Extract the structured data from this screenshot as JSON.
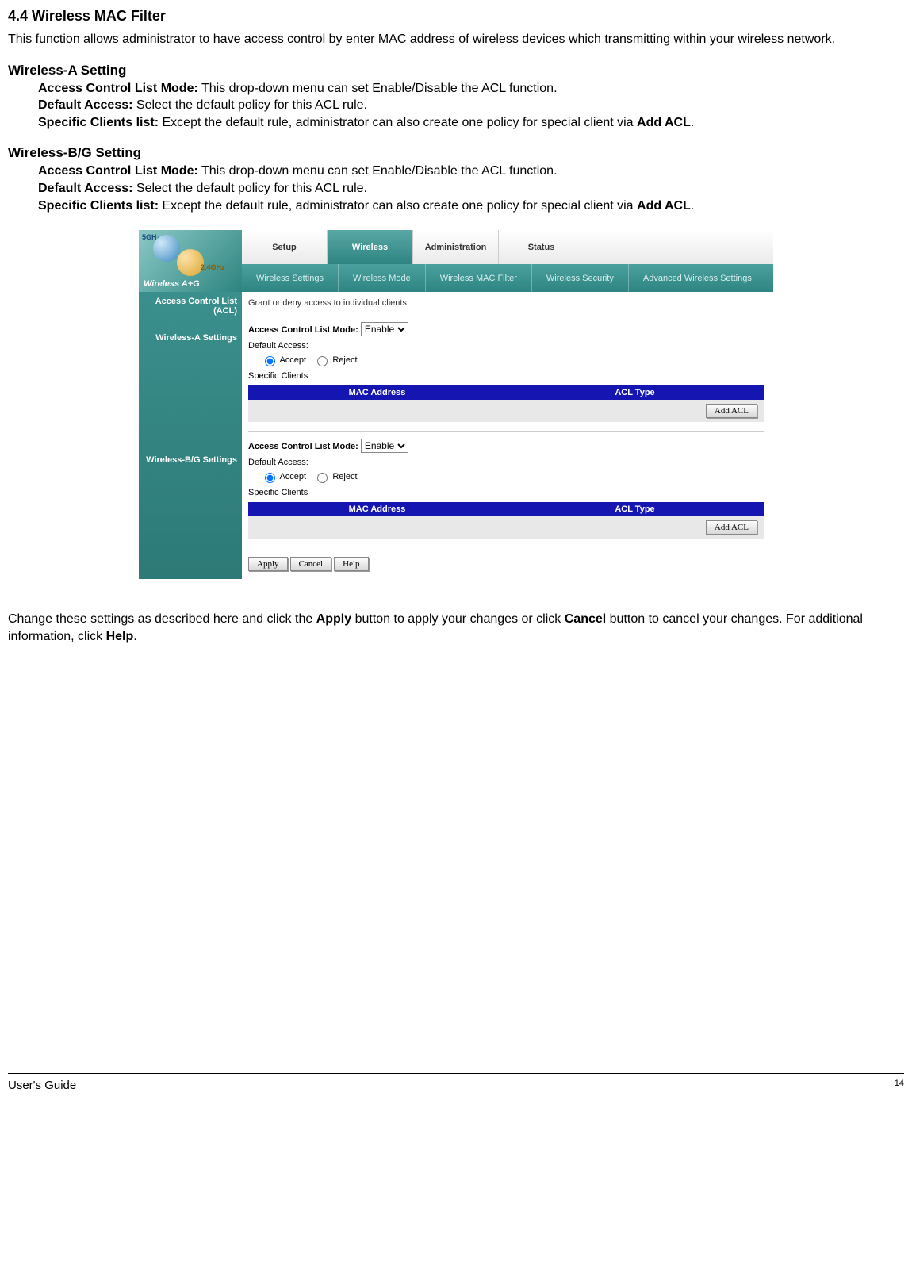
{
  "section_title": "4.4 Wireless MAC Filter",
  "intro": "This function allows administrator to have access control by enter MAC address of wireless devices which transmitting within your wireless network.",
  "wa": {
    "heading": "Wireless-A Setting",
    "acl_label": "Access Control List Mode:",
    "acl_desc": " This drop-down menu can set Enable/Disable the ACL function.",
    "da_label": "Default Access:",
    "da_desc": " Select the default policy for this ACL rule.",
    "sc_label": "Specific Clients list:",
    "sc_desc_pre": " Except the default rule, administrator can also create one policy for special client via ",
    "sc_bold": "Add ACL",
    "sc_tail": "."
  },
  "wbg": {
    "heading": "Wireless-B/G Setting",
    "acl_label": "Access Control List Mode:",
    "acl_desc": " This drop-down menu can set Enable/Disable the ACL function.",
    "da_label": "Default Access:",
    "da_desc": " Select the default policy for this ACL rule.",
    "sc_label": "Specific Clients list:",
    "sc_desc_pre": " Except the default rule, administrator can also create one policy for special client via ",
    "sc_bold": "Add ACL",
    "sc_tail": "."
  },
  "ui": {
    "logo_5g": "5GHz",
    "logo_24g": "2.4GHz",
    "logo_text": "Wireless A+G",
    "main_tabs": [
      "Setup",
      "Wireless",
      "Administration",
      "Status"
    ],
    "sub_tabs": [
      "Wireless Settings",
      "Wireless Mode",
      "Wireless MAC Filter",
      "Wireless Security",
      "Advanced Wireless Settings"
    ],
    "sidebar_acl": "Access Control List (ACL)",
    "grant_text": "Grant or deny access to individual clients.",
    "sidebar_wa": "Wireless-A Settings",
    "sidebar_wbg": "Wireless-B/G Settings",
    "acl_mode_label": "Access Control List Mode:",
    "enable_opt": "Enable",
    "default_access": "Default Access:",
    "accept": "Accept",
    "reject": "Reject",
    "specific_clients": "Specific Clients",
    "th_mac": "MAC Address",
    "th_type": "ACL Type",
    "add_acl": "Add ACL",
    "apply": "Apply",
    "cancel": "Cancel",
    "help": "Help"
  },
  "concl": {
    "pre": "Change these settings as described here and click the ",
    "b1": "Apply",
    "mid1": " button to apply your changes or click ",
    "b2": "Cancel",
    "mid2": " button to cancel your changes. For additional information, click ",
    "b3": "Help",
    "tail": "."
  },
  "footer": {
    "left": "User's Guide",
    "page": "14"
  }
}
